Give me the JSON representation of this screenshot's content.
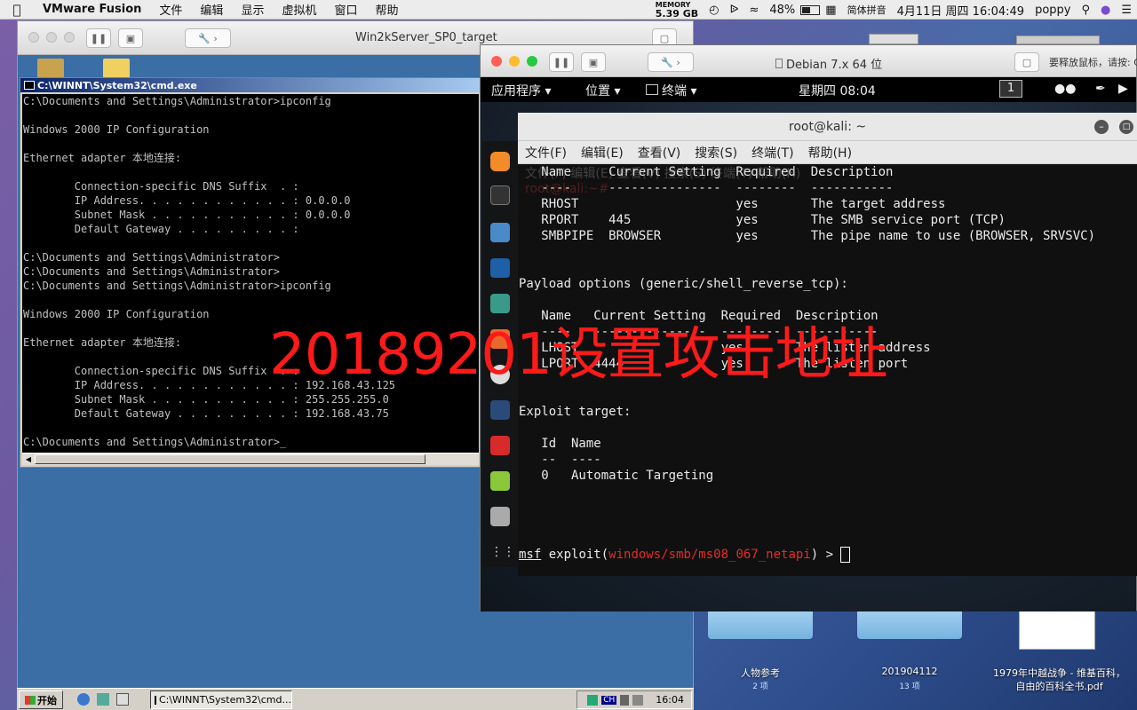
{
  "menubar": {
    "app": "VMware Fusion",
    "items": [
      "文件",
      "编辑",
      "显示",
      "虚拟机",
      "窗口",
      "帮助"
    ],
    "memory_label": "MEMORY",
    "memory_value": "5.39 GB",
    "battery": "48%",
    "input_method": "简体拼音",
    "datetime": "4月11日 周四  16:04:49",
    "user": "poppy"
  },
  "win2k_window": {
    "title": "Win2kServer_SP0_target",
    "cmd_title": "C:\\WINNT\\System32\\cmd.exe",
    "cmd_lines": [
      "C:\\Documents and Settings\\Administrator>ipconfig",
      "",
      "Windows 2000 IP Configuration",
      "",
      "Ethernet adapter 本地连接:",
      "",
      "        Connection-specific DNS Suffix  . :",
      "        IP Address. . . . . . . . . . . . : 0.0.0.0",
      "        Subnet Mask . . . . . . . . . . . : 0.0.0.0",
      "        Default Gateway . . . . . . . . . :",
      "",
      "C:\\Documents and Settings\\Administrator>",
      "C:\\Documents and Settings\\Administrator>",
      "C:\\Documents and Settings\\Administrator>ipconfig",
      "",
      "Windows 2000 IP Configuration",
      "",
      "Ethernet adapter 本地连接:",
      "",
      "        Connection-specific DNS Suffix  . :",
      "        IP Address. . . . . . . . . . . . : 192.168.43.125",
      "        Subnet Mask . . . . . . . . . . . : 255.255.255.0",
      "        Default Gateway . . . . . . . . . : 192.168.43.75",
      "",
      "C:\\Documents and Settings\\Administrator>_"
    ],
    "taskbar": {
      "start": "开始",
      "task": "C:\\WINNT\\System32\\cmd...",
      "clock": "16:04",
      "tray_lang": "CH"
    }
  },
  "debian_window": {
    "title": "Debian 7.x 64 位",
    "hint": "要释放鼠标，请按: C",
    "gnome": {
      "apps": "应用程序 ▾",
      "places": "位置 ▾",
      "terminal": "终端 ▾",
      "clock": "星期四 08:04",
      "workspace": "1"
    },
    "terminal": {
      "title": "root@kali: ~",
      "menu": [
        "文件(F)",
        "编辑(E)",
        "查看(V)",
        "搜索(S)",
        "终端(T)",
        "帮助(H)"
      ],
      "ghost_menu": "文件(F)   编辑(E)   查看(V)   搜索(S)   终端(T)   帮助(H)",
      "ghost_prompt": "root@kali:~#",
      "prompt_module": "windows/smb/ms08_067_netapi",
      "lines": [
        "   Name     Current Setting  Required  Description",
        "   ----     ---------------  --------  -----------",
        "   RHOST                     yes       The target address",
        "   RPORT    445              yes       The SMB service port (TCP)",
        "   SMBPIPE  BROWSER          yes       The pipe name to use (BROWSER, SRVSVC)",
        "",
        "",
        "Payload options (generic/shell_reverse_tcp):",
        "",
        "   Name   Current Setting  Required  Description",
        "   ----   ---------------  --------  -----------",
        "   LHOST                   yes       The listen address",
        "   LPORT  4444             yes       The listen port",
        "",
        "",
        "Exploit target:",
        "",
        "   Id  Name",
        "   --  ----",
        "   0   Automatic Targeting",
        ""
      ]
    }
  },
  "overlay": "20189201设置攻击地址",
  "desktop_items": [
    {
      "label": "人物参考",
      "sub": "2 项"
    },
    {
      "label": "201904112",
      "sub": "13 项"
    },
    {
      "label": "1979年中越战争 - 维基百科，自由的百科全书.pdf",
      "sub": ""
    }
  ],
  "desktop_item_lines": [
    "1979年中越战争 - 维基百科，",
    "自由的百科全书.pdf"
  ]
}
